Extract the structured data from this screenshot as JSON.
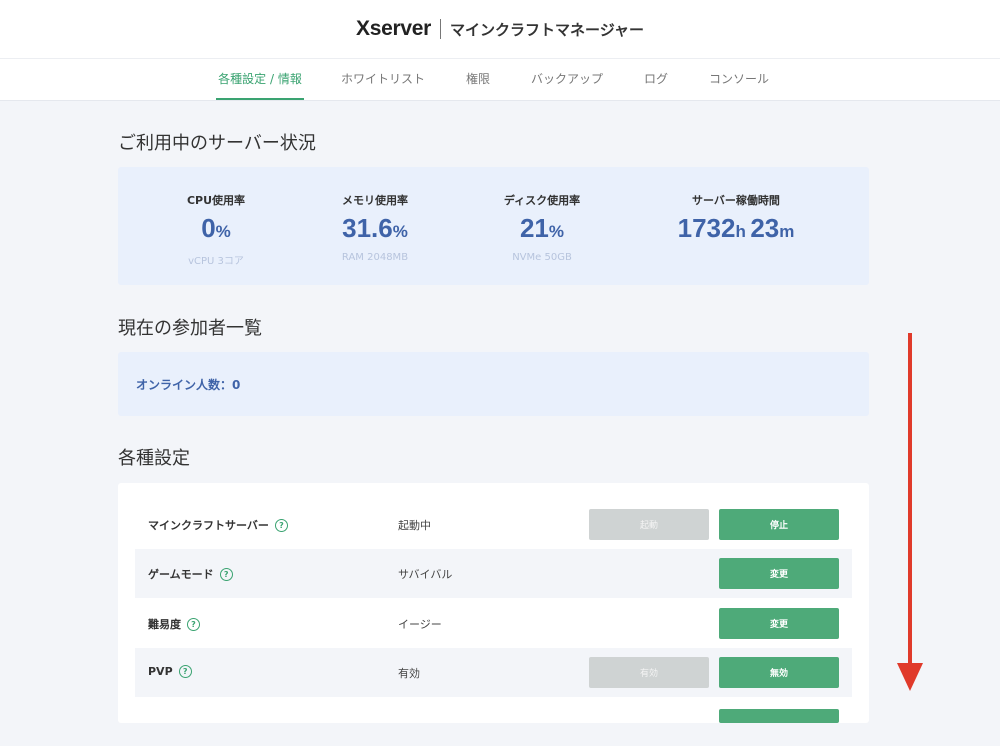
{
  "header": {
    "logo": "Xserver",
    "subtitle": "マインクラフトマネージャー"
  },
  "tabs": [
    {
      "label": "各種設定 / 情報",
      "active": true
    },
    {
      "label": "ホワイトリスト"
    },
    {
      "label": "権限"
    },
    {
      "label": "バックアップ"
    },
    {
      "label": "ログ"
    },
    {
      "label": "コンソール"
    }
  ],
  "status": {
    "title": "ご利用中のサーバー状況",
    "cpu": {
      "label": "CPU使用率",
      "value": "0",
      "unit": "%",
      "sub": "vCPU 3コア"
    },
    "memory": {
      "label": "メモリ使用率",
      "value": "31.6",
      "unit": "%",
      "sub": "RAM 2048MB"
    },
    "disk": {
      "label": "ディスク使用率",
      "value": "21",
      "unit": "%",
      "sub": "NVMe 50GB"
    },
    "uptime": {
      "label": "サーバー稼働時間",
      "hours": "1732",
      "hours_unit": "h",
      "minutes": "23",
      "minutes_unit": "m"
    }
  },
  "players": {
    "title": "現在の参加者一覧",
    "online": "オンライン人数：0"
  },
  "settings": {
    "title": "各種設定",
    "rows": [
      {
        "label": "マインクラフトサーバー",
        "value": "起動中",
        "btn1": "起動",
        "btn2": "停止"
      },
      {
        "label": "ゲームモード",
        "value": "サバイバル",
        "btn2": "変更"
      },
      {
        "label": "難易度",
        "value": "イージー",
        "btn2": "変更"
      },
      {
        "label": "PVP",
        "value": "有効",
        "btn1": "有効",
        "btn2": "無効"
      }
    ]
  },
  "help_glyph": "?",
  "colors": {
    "accent_green": "#3aa371",
    "button_green": "#4eaa79",
    "stat_blue": "#3f63a8",
    "panel_blue": "#e9f0fc",
    "arrow_red": "#e03a2b"
  }
}
